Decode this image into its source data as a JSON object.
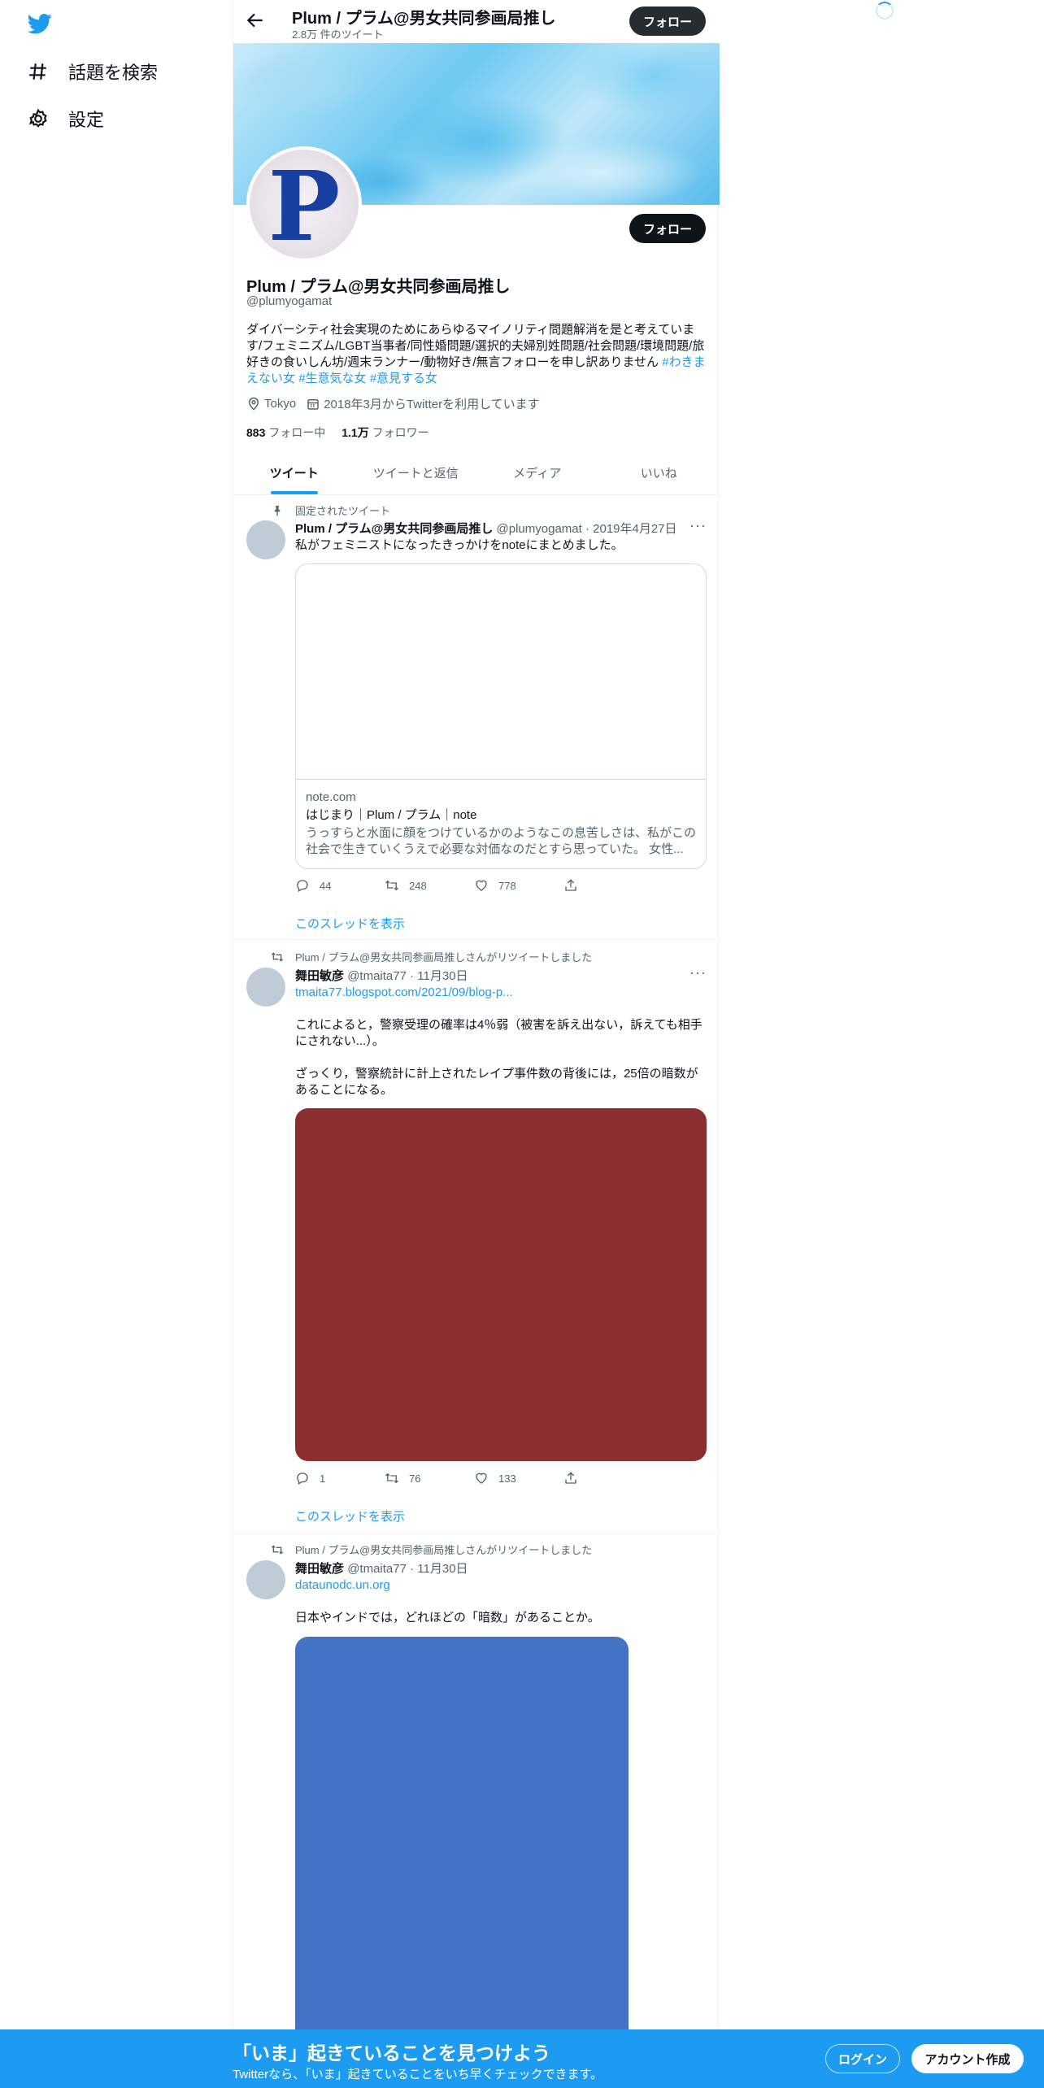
{
  "sidebar": {
    "items": [
      {
        "label": "話題を検索",
        "icon": "hashtag-icon"
      },
      {
        "label": "設定",
        "icon": "gear-icon"
      }
    ]
  },
  "header": {
    "title": "Plum / プラム@男女共同参画局推し",
    "subtitle": "2.8万 件のツイート",
    "follow_label": "フォロー"
  },
  "profile": {
    "avatar_letter": "P",
    "follow_label": "フォロー",
    "name": "Plum / プラム@男女共同参画局推し",
    "handle": "@plumyogamat",
    "bio": "ダイバーシティ社会実現のためにあらゆるマイノリティ問題解消を是と考えています/フェミニズム/LGBT当事者/同性婚問題/選択的夫婦別姓問題/社会問題/環境問題/旅好きの食いしん坊/週末ランナー/動物好き/無言フォローを申し訳ありません ",
    "hashtags": [
      "#わきまえない女",
      "#生意気な女",
      "#意見する女"
    ],
    "location": "Tokyo",
    "joined": "2018年3月からTwitterを利用しています",
    "following_count": "883",
    "following_label": "フォロー中",
    "followers_count": "1.1万",
    "followers_label": "フォロワー"
  },
  "tabs": [
    {
      "label": "ツイート",
      "active": true
    },
    {
      "label": "ツイートと返信",
      "active": false
    },
    {
      "label": "メディア",
      "active": false
    },
    {
      "label": "いいね",
      "active": false
    }
  ],
  "tweets": [
    {
      "context": "固定されたツイート",
      "author": "Plum / プラム@男女共同参画局推し",
      "handle_date": "@plumyogamat · 2019年4月27日",
      "text": "私がフェミニストになったきっかけをnoteにまとめました。",
      "card": {
        "domain": "note.com",
        "title": "はじまり｜Plum / プラム｜note",
        "description": "うっすらと水面に顔をつけているかのようなこの息苦しさは、私がこの社会で生きていくうえで必要な対価なのだとすら思っていた。 女性..."
      },
      "replies": "44",
      "retweets": "248",
      "likes": "778",
      "thread": "このスレッドを表示"
    },
    {
      "context": "Plum / プラム@男女共同参画局推しさんがリツイートしました",
      "author": "舞田敏彦",
      "handle_date": "@tmaita77 · 11月30日",
      "link": "tmaita77.blogspot.com/2021/09/blog-p...",
      "text1": "これによると，警察受理の確率は4％弱（被害を訴え出ない，訴えても相手にされない...）。",
      "text2": "ざっくり，警察統計に計上されたレイプ事件数の背後には，25倍の暗数があることになる。",
      "media_color": "#8b2e2f",
      "replies": "1",
      "retweets": "76",
      "likes": "133",
      "thread": "このスレッドを表示"
    },
    {
      "context": "Plum / プラム@男女共同参画局推しさんがリツイートしました",
      "author": "舞田敏彦",
      "handle_date": "@tmaita77 · 11月30日",
      "link": "dataunodc.un.org",
      "text1": "日本やインドでは，どれほどの「暗数」があることか。",
      "media_color": "#4472c4"
    }
  ],
  "bottom_bar": {
    "title": "「いま」起きていることを見つけよう",
    "subtitle": "Twitterなら、「いま」起きていることをいち早くチェックできます。",
    "login_label": "ログイン",
    "signup_label": "アカウント作成"
  }
}
